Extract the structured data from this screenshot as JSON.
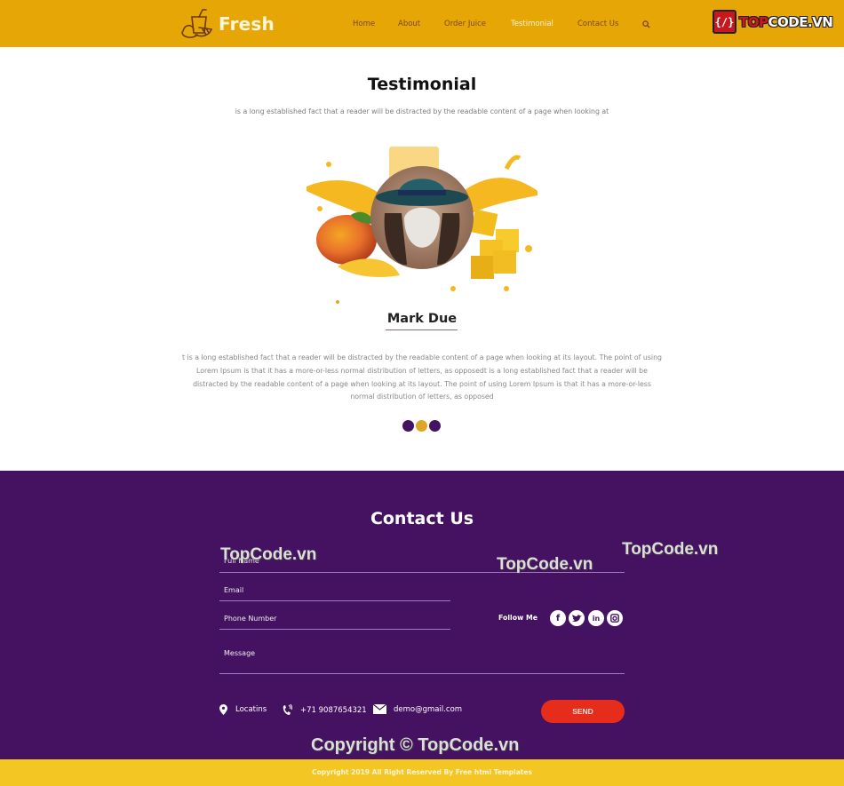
{
  "header": {
    "logo_text": "Fresh",
    "nav": [
      "Home",
      "About",
      "Order Juice",
      "Testimonial",
      "Contact Us"
    ],
    "active_nav": "Testimonial",
    "brand_badge": "{/}",
    "brand_prefix": "TOP",
    "brand_suffix": "CODE.VN"
  },
  "testimonial": {
    "title": "Testimonial",
    "subtitle": "is a long established fact that a reader will be distracted by the readable content of a page when looking at",
    "name": "Mark Due",
    "body": "t is a long established fact that a reader will be distracted by the readable content of a page when looking at its layout. The point of using Lorem Ipsum is that it has a more-or-less normal distribution of letters, as opposedt is a long established fact that a reader will be distracted by the readable content of a page when looking at its layout. The point of using Lorem Ipsum is that it has a more-or-less normal distribution of letters, as opposed",
    "carousel_dots": 3,
    "active_dot": 2
  },
  "contact": {
    "title": "Contact Us",
    "fields": {
      "full_name": "Full Name",
      "email": "Email",
      "phone": "Phone Number",
      "message": "Message"
    },
    "follow_label": "Follow Me",
    "social": [
      "facebook",
      "twitter",
      "linkedin",
      "instagram"
    ],
    "location": "Locatins",
    "phone": "+71 9087654321",
    "email": "demo@gmail.com",
    "send_label": "SEND"
  },
  "watermarks": {
    "w1": "TopCode.vn",
    "w2": "TopCode.vn",
    "w3": "TopCode.vn",
    "copyright": "Copyright © TopCode.vn"
  },
  "footer": {
    "text": "Copyright 2019 All Right Reserved By Free html Templates"
  },
  "colors": {
    "header_bg": "#e6a605",
    "contact_bg": "#441260",
    "footer_bg": "#f4c623",
    "send_button": "#e62d1c",
    "dot_purple": "#441260",
    "dot_gold": "#e0a526"
  }
}
